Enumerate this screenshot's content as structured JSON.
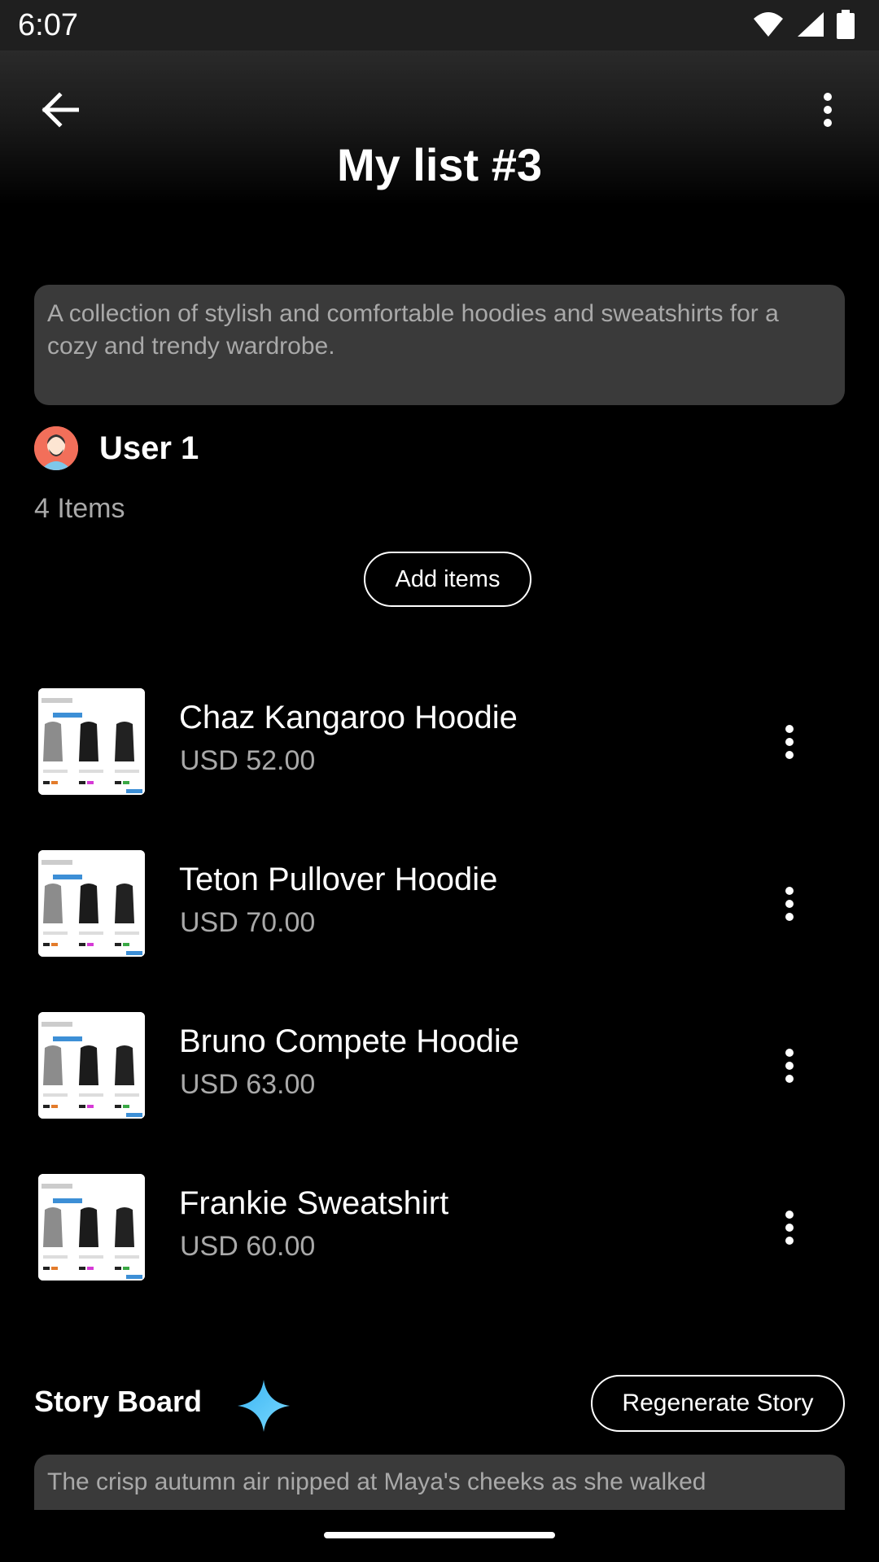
{
  "status_bar": {
    "time": "6:07"
  },
  "header": {
    "title": "My list #3"
  },
  "description": "A collection of stylish and comfortable hoodies and sweatshirts for a cozy and trendy wardrobe.",
  "user": {
    "name": "User 1"
  },
  "item_count": "4 Items",
  "add_items_label": "Add items",
  "items": [
    {
      "name": "Chaz Kangaroo Hoodie",
      "price": "USD 52.00"
    },
    {
      "name": "Teton Pullover Hoodie",
      "price": "USD 70.00"
    },
    {
      "name": "Bruno Compete Hoodie",
      "price": "USD 63.00"
    },
    {
      "name": "Frankie Sweatshirt",
      "price": "USD 60.00"
    }
  ],
  "story_board": {
    "title": "Story Board",
    "regenerate_label": "Regenerate Story",
    "text": "The crisp autumn air nipped at Maya's cheeks as she walked"
  },
  "icons": {
    "back": "arrow-back-icon",
    "more": "more-vertical-icon",
    "sparkle": "sparkle-icon"
  }
}
